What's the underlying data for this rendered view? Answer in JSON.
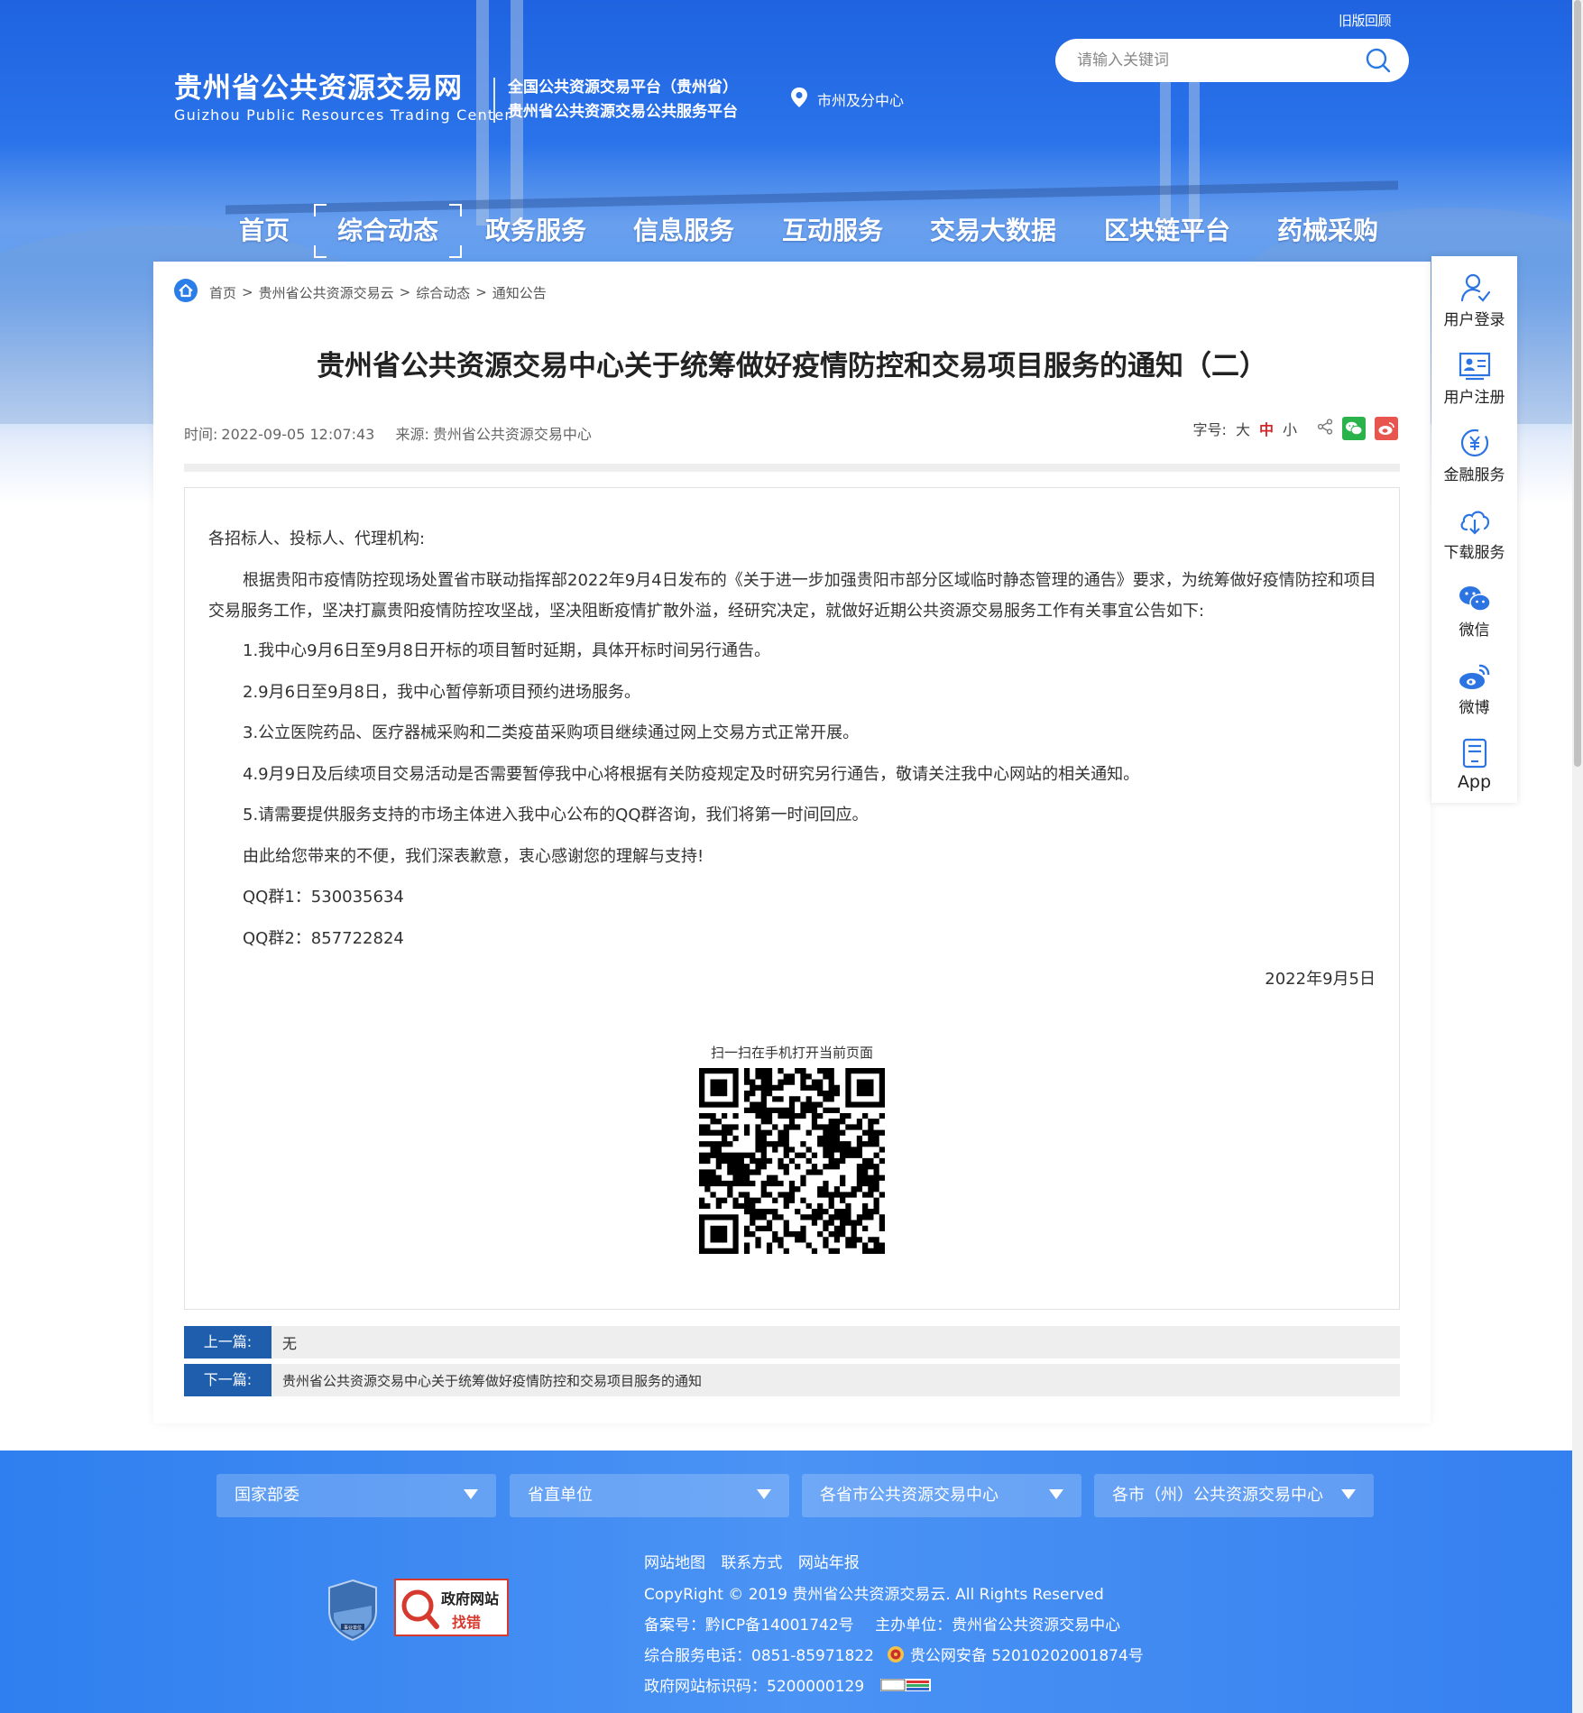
{
  "header": {
    "old_version": "旧版回顾",
    "search_placeholder": "请输入关键词",
    "logo_cn": "贵州省公共资源交易网",
    "logo_en": "Guizhou Public Resources Trading Center",
    "sub_line1": "全国公共资源交易平台（贵州省）",
    "sub_line2": "贵州省公共资源交易公共服务平台",
    "city_center": "市州及分中心"
  },
  "nav": {
    "items": [
      "首页",
      "综合动态",
      "政务服务",
      "信息服务",
      "互动服务",
      "交易大数据",
      "区块链平台",
      "药械采购"
    ],
    "active_index": 1
  },
  "breadcrumb": [
    "首页",
    "贵州省公共资源交易云",
    "综合动态",
    "通知公告"
  ],
  "article": {
    "title": "贵州省公共资源交易中心关于统筹做好疫情防控和交易项目服务的通知（二）",
    "time_label": "时间:",
    "time": "2022-09-05 12:07:43",
    "source_label": "来源:",
    "source": "贵州省公共资源交易中心",
    "font_label": "字号:",
    "font_large": "大",
    "font_medium": "中",
    "font_small": "小",
    "salutation": "各招标人、投标人、代理机构:",
    "main_para": "根据贵阳市疫情防控现场处置省市联动指挥部2022年9月4日发布的《关于进一步加强贵阳市部分区域临时静态管理的通告》要求，为统筹做好疫情防控和项目交易服务工作，坚决打赢贵阳疫情防控攻坚战，坚决阻断疫情扩散外溢，经研究决定，就做好近期公共资源交易服务工作有关事宜公告如下:",
    "items": [
      "1.我中心9月6日至9月8日开标的项目暂时延期，具体开标时间另行通告。",
      "2.9月6日至9月8日，我中心暂停新项目预约进场服务。",
      "3.公立医院药品、医疗器械采购和二类疫苗采购项目继续通过网上交易方式正常开展。",
      "4.9月9日及后续项目交易活动是否需要暂停我中心将根据有关防疫规定及时研究另行通告，敬请关注我中心网站的相关通知。",
      "5.请需要提供服务支持的市场主体进入我中心公布的QQ群咨询，我们将第一时间回应。",
      "由此给您带来的不便，我们深表歉意，衷心感谢您的理解与支持!",
      "QQ群1：530035634",
      "QQ群2：857722824"
    ],
    "date": "2022年9月5日",
    "qr_label": "扫一扫在手机打开当前页面",
    "prev_label": "上一篇:",
    "prev_text": "无",
    "next_label": "下一篇:",
    "next_text": "贵州省公共资源交易中心关于统筹做好疫情防控和交易项目服务的通知"
  },
  "float_bar": [
    {
      "label": "用户登录",
      "icon": "user-login-icon"
    },
    {
      "label": "用户注册",
      "icon": "user-register-icon"
    },
    {
      "label": "金融服务",
      "icon": "finance-icon"
    },
    {
      "label": "下载服务",
      "icon": "download-cloud-icon"
    },
    {
      "label": "微信",
      "icon": "wechat-icon"
    },
    {
      "label": "微博",
      "icon": "weibo-icon"
    },
    {
      "label": "App",
      "icon": "app-icon"
    }
  ],
  "footer": {
    "dropdowns": [
      "国家部委",
      "省直单位",
      "各省市公共资源交易中心",
      "各市（州）公共资源交易中心"
    ],
    "links": [
      "网站地图",
      "联系方式",
      "网站年报"
    ],
    "copyright": "CopyRight © 2019 贵州省公共资源交易云. All Rights Reserved",
    "icp": "备案号：黔ICP备14001742号",
    "host": "主办单位：贵州省公共资源交易中心",
    "phone": "综合服务电话：0851-85971822",
    "police": "贵公网安备 52010202001874号",
    "gov_id": "政府网站标识码：5200000129",
    "badge_gov_line1": "政府网站",
    "badge_gov_line2": "找错",
    "badge_shield_text": "事业单位"
  },
  "colors": {
    "primary_blue": "#1f5dad",
    "accent_red": "#d6262a",
    "footer_blue": "#3b87f2"
  }
}
